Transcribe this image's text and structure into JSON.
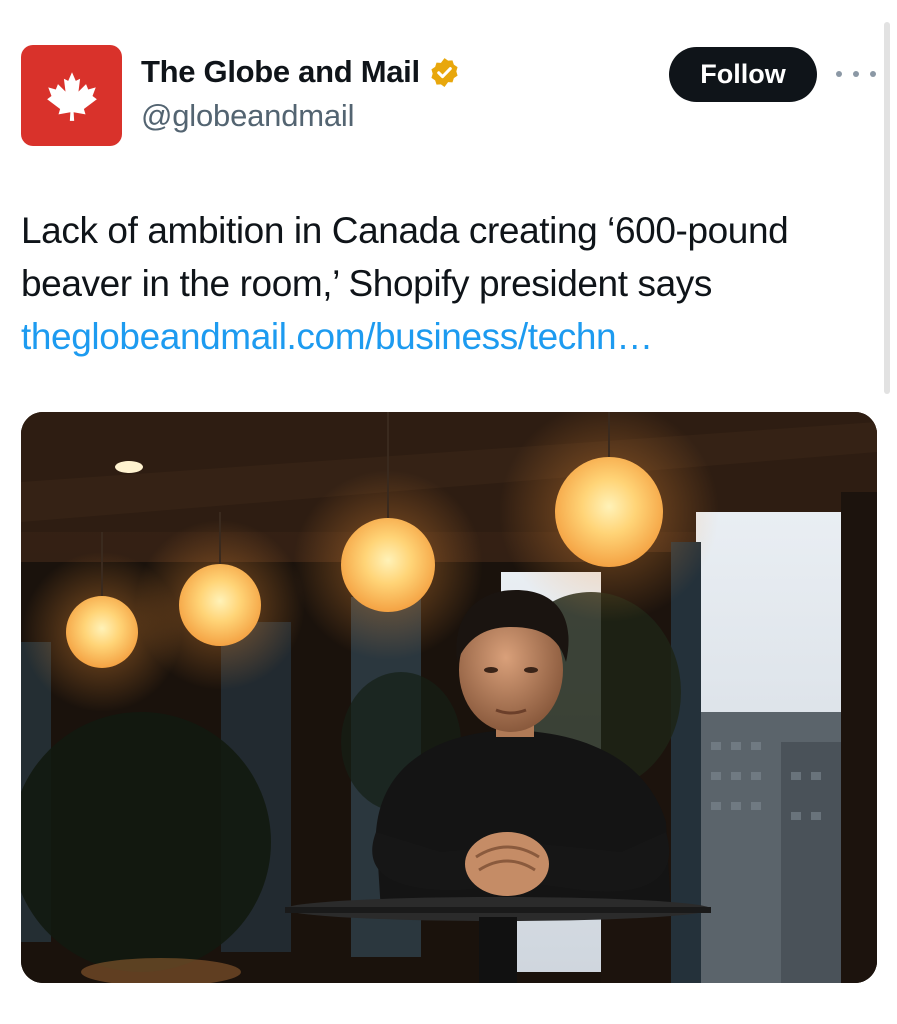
{
  "account": {
    "display_name": "The Globe and Mail",
    "handle": "@globeandmail",
    "verified_badge_icon": "gold-verified-badge-icon",
    "avatar_icon": "maple-leaf-icon",
    "avatar_color": "#d9322b"
  },
  "actions": {
    "follow_label": "Follow",
    "more_icon": "more-horizontal-icon"
  },
  "tweet": {
    "text": "Lack of ambition in Canada creating ‘600-pound beaver in the room,’ Shopify president says",
    "link": "theglobeandmail.com/business/techn…"
  },
  "media": {
    "type": "photo"
  },
  "colors": {
    "link": "#1d9bf0",
    "text": "#0f1419",
    "secondary": "#536471",
    "badge": "#e8a70c"
  }
}
